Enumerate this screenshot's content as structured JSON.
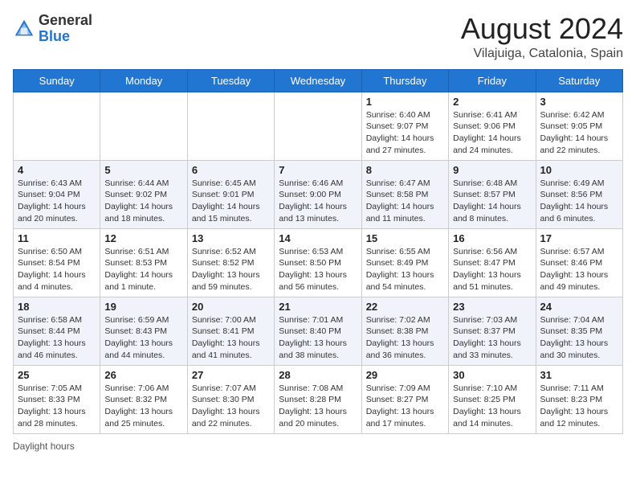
{
  "logo": {
    "text_general": "General",
    "text_blue": "Blue"
  },
  "title": "August 2024",
  "location": "Vilajuiga, Catalonia, Spain",
  "days_of_week": [
    "Sunday",
    "Monday",
    "Tuesday",
    "Wednesday",
    "Thursday",
    "Friday",
    "Saturday"
  ],
  "footer": "Daylight hours",
  "weeks": [
    [
      {
        "day": "",
        "info": ""
      },
      {
        "day": "",
        "info": ""
      },
      {
        "day": "",
        "info": ""
      },
      {
        "day": "",
        "info": ""
      },
      {
        "day": "1",
        "info": "Sunrise: 6:40 AM\nSunset: 9:07 PM\nDaylight: 14 hours and 27 minutes."
      },
      {
        "day": "2",
        "info": "Sunrise: 6:41 AM\nSunset: 9:06 PM\nDaylight: 14 hours and 24 minutes."
      },
      {
        "day": "3",
        "info": "Sunrise: 6:42 AM\nSunset: 9:05 PM\nDaylight: 14 hours and 22 minutes."
      }
    ],
    [
      {
        "day": "4",
        "info": "Sunrise: 6:43 AM\nSunset: 9:04 PM\nDaylight: 14 hours and 20 minutes."
      },
      {
        "day": "5",
        "info": "Sunrise: 6:44 AM\nSunset: 9:02 PM\nDaylight: 14 hours and 18 minutes."
      },
      {
        "day": "6",
        "info": "Sunrise: 6:45 AM\nSunset: 9:01 PM\nDaylight: 14 hours and 15 minutes."
      },
      {
        "day": "7",
        "info": "Sunrise: 6:46 AM\nSunset: 9:00 PM\nDaylight: 14 hours and 13 minutes."
      },
      {
        "day": "8",
        "info": "Sunrise: 6:47 AM\nSunset: 8:58 PM\nDaylight: 14 hours and 11 minutes."
      },
      {
        "day": "9",
        "info": "Sunrise: 6:48 AM\nSunset: 8:57 PM\nDaylight: 14 hours and 8 minutes."
      },
      {
        "day": "10",
        "info": "Sunrise: 6:49 AM\nSunset: 8:56 PM\nDaylight: 14 hours and 6 minutes."
      }
    ],
    [
      {
        "day": "11",
        "info": "Sunrise: 6:50 AM\nSunset: 8:54 PM\nDaylight: 14 hours and 4 minutes."
      },
      {
        "day": "12",
        "info": "Sunrise: 6:51 AM\nSunset: 8:53 PM\nDaylight: 14 hours and 1 minute."
      },
      {
        "day": "13",
        "info": "Sunrise: 6:52 AM\nSunset: 8:52 PM\nDaylight: 13 hours and 59 minutes."
      },
      {
        "day": "14",
        "info": "Sunrise: 6:53 AM\nSunset: 8:50 PM\nDaylight: 13 hours and 56 minutes."
      },
      {
        "day": "15",
        "info": "Sunrise: 6:55 AM\nSunset: 8:49 PM\nDaylight: 13 hours and 54 minutes."
      },
      {
        "day": "16",
        "info": "Sunrise: 6:56 AM\nSunset: 8:47 PM\nDaylight: 13 hours and 51 minutes."
      },
      {
        "day": "17",
        "info": "Sunrise: 6:57 AM\nSunset: 8:46 PM\nDaylight: 13 hours and 49 minutes."
      }
    ],
    [
      {
        "day": "18",
        "info": "Sunrise: 6:58 AM\nSunset: 8:44 PM\nDaylight: 13 hours and 46 minutes."
      },
      {
        "day": "19",
        "info": "Sunrise: 6:59 AM\nSunset: 8:43 PM\nDaylight: 13 hours and 44 minutes."
      },
      {
        "day": "20",
        "info": "Sunrise: 7:00 AM\nSunset: 8:41 PM\nDaylight: 13 hours and 41 minutes."
      },
      {
        "day": "21",
        "info": "Sunrise: 7:01 AM\nSunset: 8:40 PM\nDaylight: 13 hours and 38 minutes."
      },
      {
        "day": "22",
        "info": "Sunrise: 7:02 AM\nSunset: 8:38 PM\nDaylight: 13 hours and 36 minutes."
      },
      {
        "day": "23",
        "info": "Sunrise: 7:03 AM\nSunset: 8:37 PM\nDaylight: 13 hours and 33 minutes."
      },
      {
        "day": "24",
        "info": "Sunrise: 7:04 AM\nSunset: 8:35 PM\nDaylight: 13 hours and 30 minutes."
      }
    ],
    [
      {
        "day": "25",
        "info": "Sunrise: 7:05 AM\nSunset: 8:33 PM\nDaylight: 13 hours and 28 minutes."
      },
      {
        "day": "26",
        "info": "Sunrise: 7:06 AM\nSunset: 8:32 PM\nDaylight: 13 hours and 25 minutes."
      },
      {
        "day": "27",
        "info": "Sunrise: 7:07 AM\nSunset: 8:30 PM\nDaylight: 13 hours and 22 minutes."
      },
      {
        "day": "28",
        "info": "Sunrise: 7:08 AM\nSunset: 8:28 PM\nDaylight: 13 hours and 20 minutes."
      },
      {
        "day": "29",
        "info": "Sunrise: 7:09 AM\nSunset: 8:27 PM\nDaylight: 13 hours and 17 minutes."
      },
      {
        "day": "30",
        "info": "Sunrise: 7:10 AM\nSunset: 8:25 PM\nDaylight: 13 hours and 14 minutes."
      },
      {
        "day": "31",
        "info": "Sunrise: 7:11 AM\nSunset: 8:23 PM\nDaylight: 13 hours and 12 minutes."
      }
    ]
  ]
}
